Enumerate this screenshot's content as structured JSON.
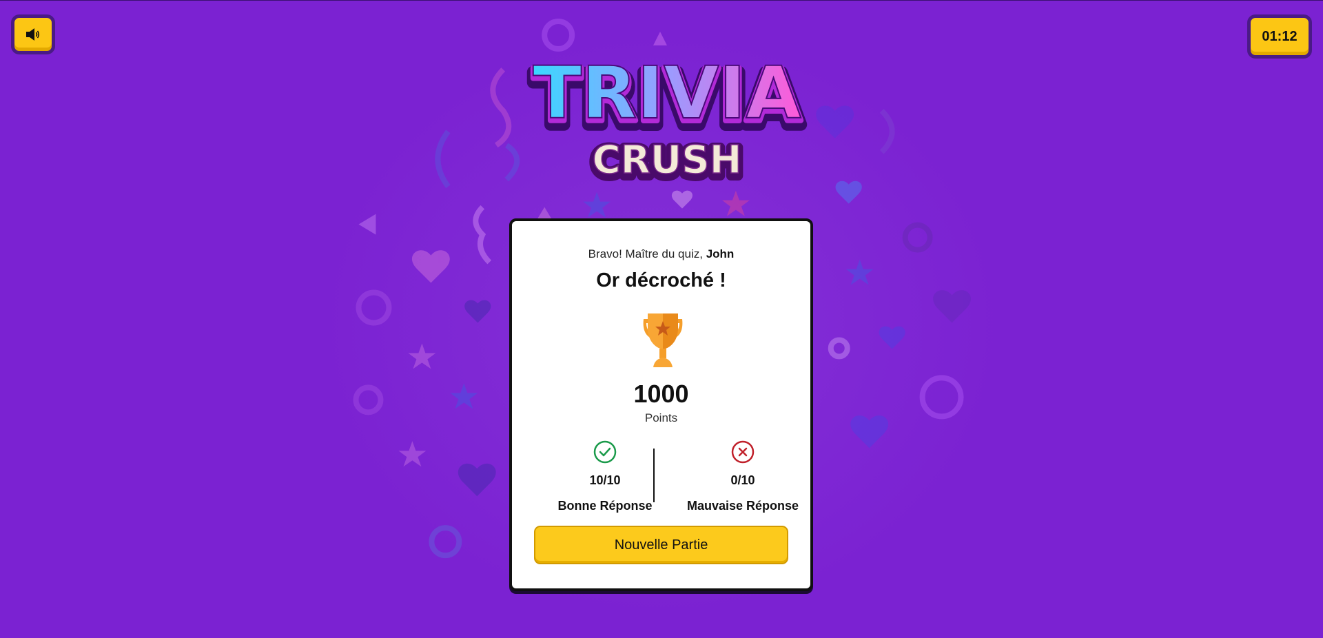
{
  "controls": {
    "sound_icon": "speaker-icon",
    "timer": "01:12"
  },
  "logo": {
    "line1": "TRIVIA",
    "line2": "CRUSH"
  },
  "result": {
    "greeting_prefix": "Bravo! Maître du quiz, ",
    "player_name": "John",
    "headline": "Or décroché !",
    "trophy_icon": "trophy-icon",
    "score": "1000",
    "score_label": "Points",
    "correct": {
      "icon": "check-circle-icon",
      "value": "10/10",
      "label": "Bonne Réponse",
      "color": "#1a9a4a"
    },
    "wrong": {
      "icon": "x-circle-icon",
      "value": "0/10",
      "label": "Mauvaise Réponse",
      "color": "#c0202a"
    },
    "new_game_label": "Nouvelle Partie"
  },
  "colors": {
    "background": "#7b22d2",
    "button": "#fcc614"
  }
}
